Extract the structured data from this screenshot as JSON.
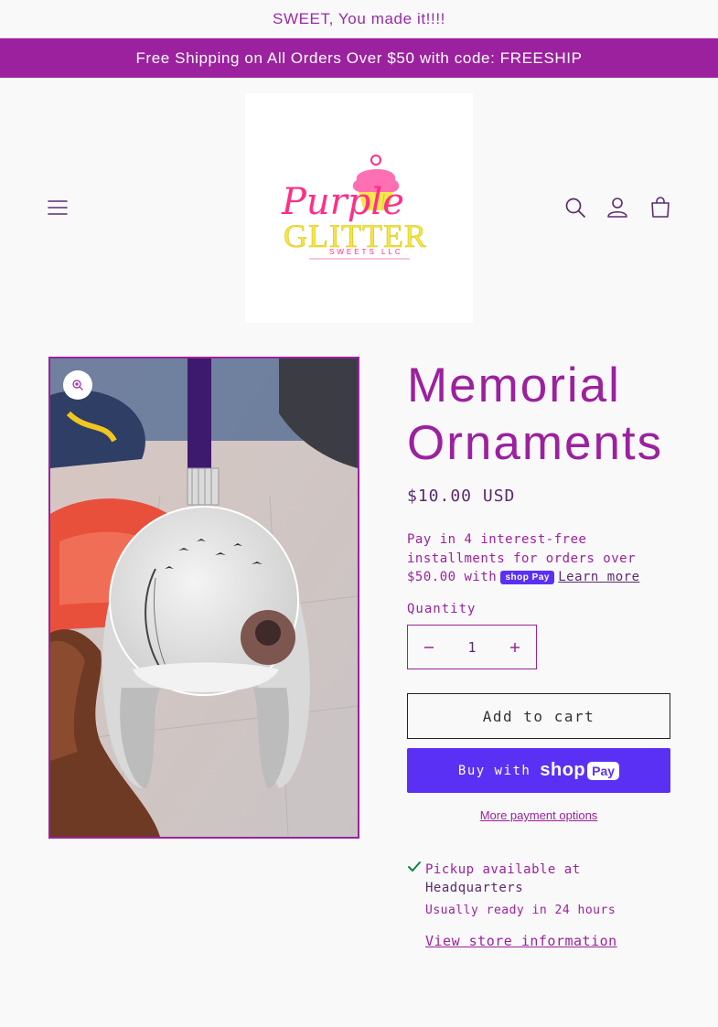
{
  "announcement": {
    "top_text": "SWEET, You made it!!!!",
    "bar_text": "Free Shipping on All Orders Over $50 with code: FREESHIP"
  },
  "header": {
    "logo_text_top": "Purple",
    "logo_text_main": "GLITTER",
    "logo_text_sub": "SWEETS LLC",
    "icons": [
      "menu-icon",
      "search-icon",
      "account-icon",
      "cart-icon"
    ]
  },
  "product": {
    "title": "Memorial Ornaments",
    "price": "$10.00 USD",
    "installments_text": "Pay in 4 interest-free installments for orders over $50.00 with",
    "shop_pay_label": "shop Pay",
    "learn_more": "Learn more",
    "quantity_label": "Quantity",
    "quantity_value": "1",
    "add_to_cart": "Add to cart",
    "buy_with": "Buy with",
    "shop_word": "shop",
    "pay_word": "Pay",
    "more_payment": "More payment options"
  },
  "pickup": {
    "available_text": "Pickup available at",
    "location": "Headquarters",
    "ready_text": "Usually ready in 24 hours",
    "store_info": "View store information"
  },
  "colors": {
    "brand_purple": "#9c219f",
    "shop_pay": "#5a31f4",
    "text_dark": "#5b2a6e",
    "check_green": "#108043"
  }
}
